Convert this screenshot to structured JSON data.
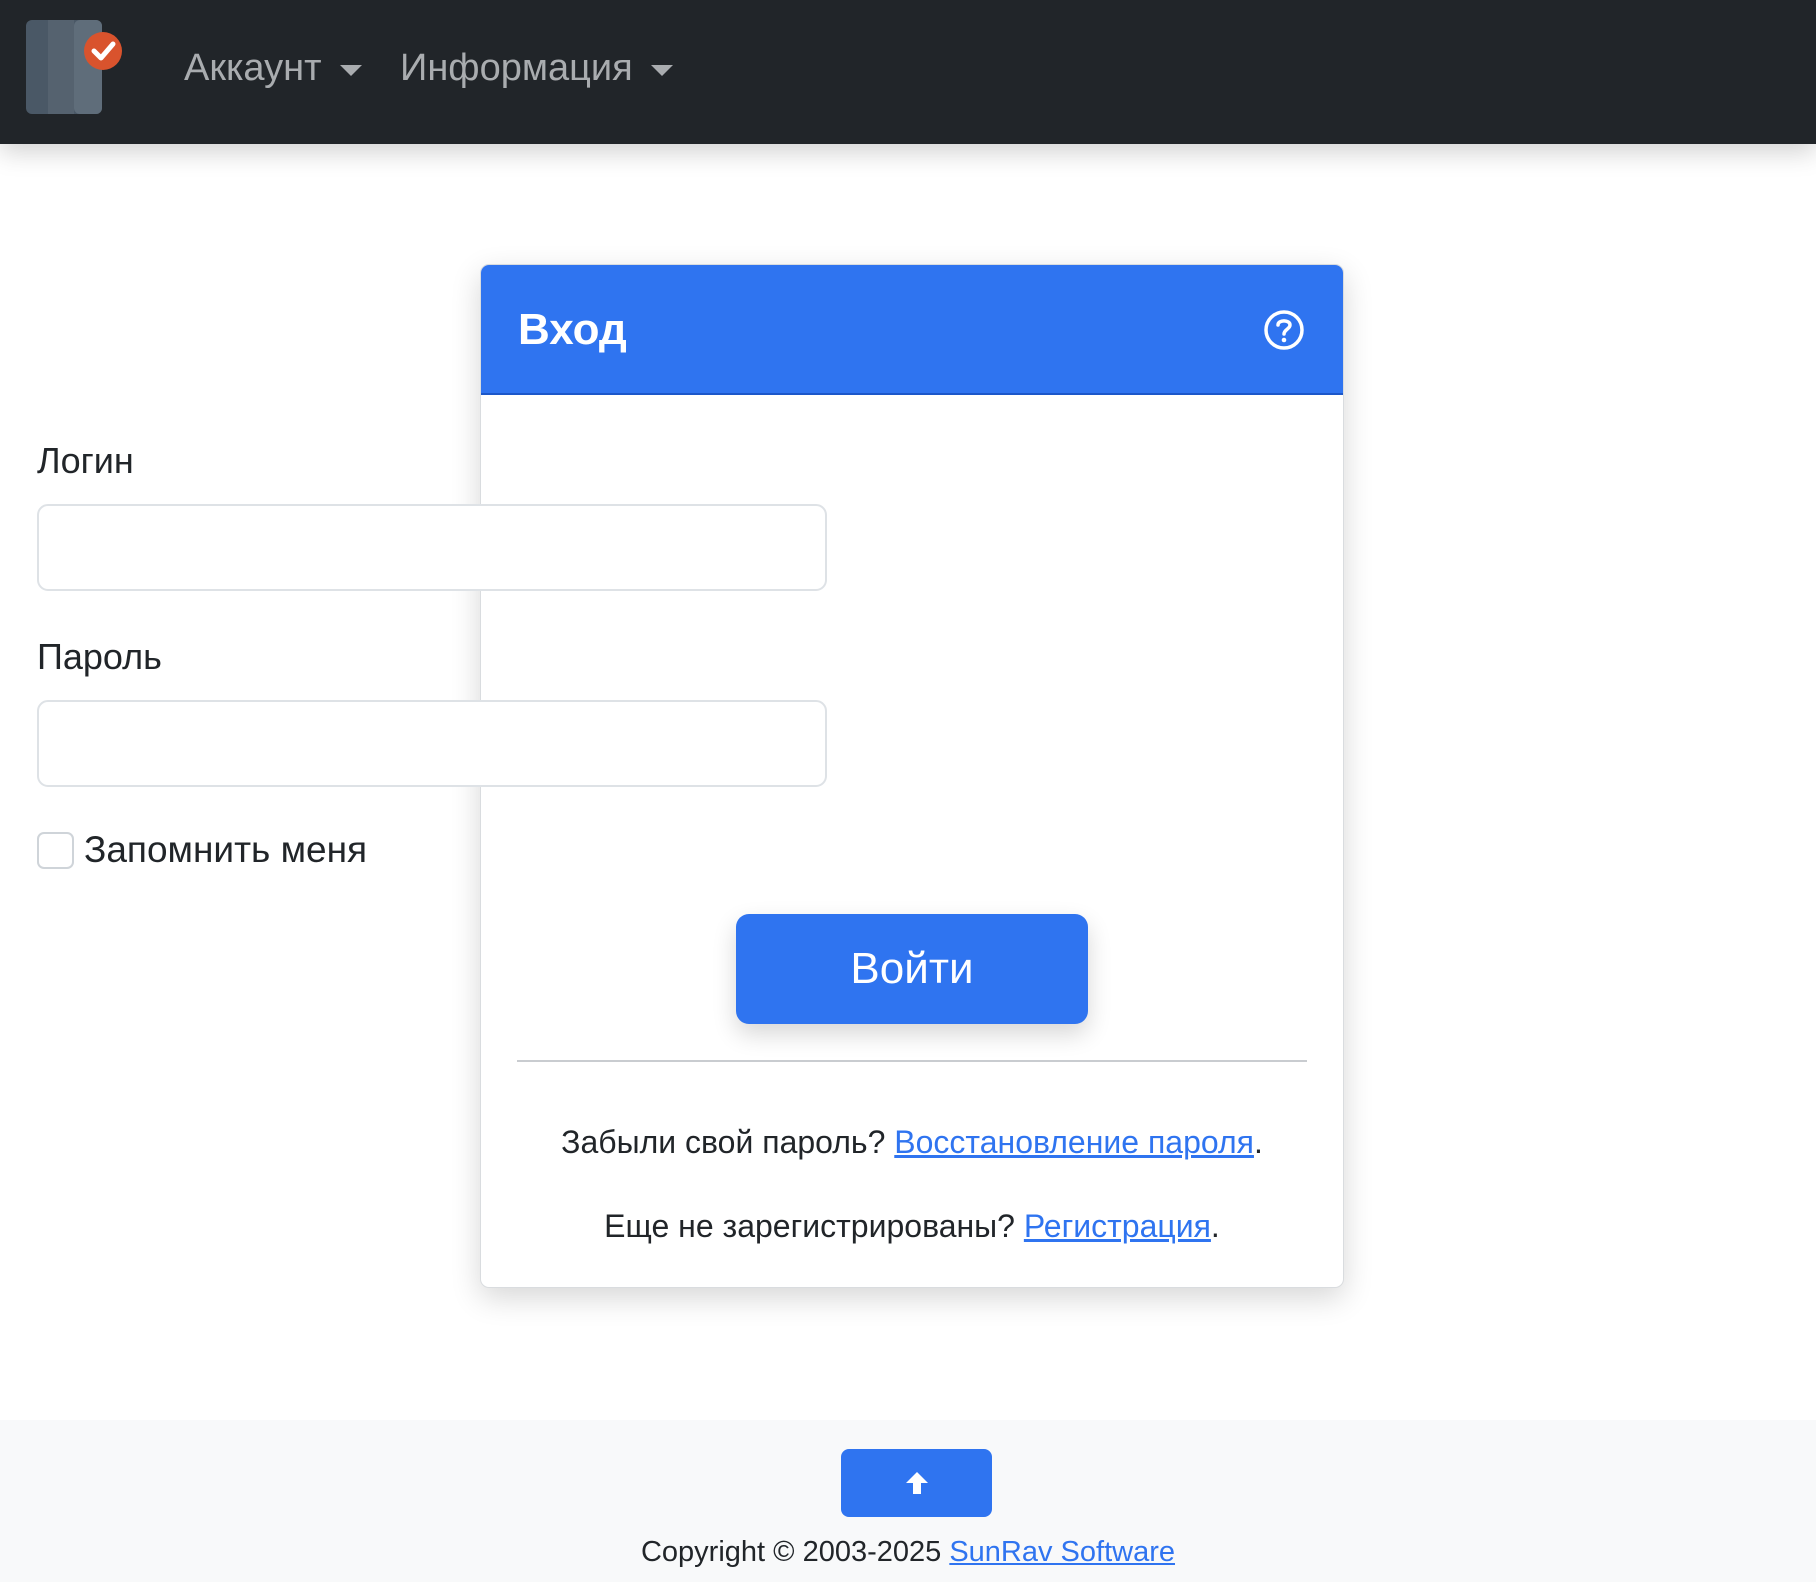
{
  "navbar": {
    "logo_name": "app-logo",
    "items": [
      {
        "label": "Аккаунт"
      },
      {
        "label": "Информация"
      }
    ]
  },
  "login_card": {
    "title": "Вход",
    "help_icon": "question-circle-icon",
    "login_label": "Логин",
    "login_value": "",
    "login_placeholder": "",
    "password_label": "Пароль",
    "password_value": "",
    "password_placeholder": "",
    "remember_label": "Запомнить меня",
    "remember_checked": false,
    "submit_label": "Войти",
    "forgot_text": "Забыли свой пароль? ",
    "forgot_link": "Восстановление пароля",
    "forgot_end": ".",
    "register_text": "Еще не зарегистрированы? ",
    "register_link": "Регистрация",
    "register_end": "."
  },
  "footer": {
    "scroll_top_icon": "arrow-up-icon",
    "copyright_text": "Copyright © 2003-2025 ",
    "company_link": "SunRav Software"
  },
  "colors": {
    "navbar_bg": "#212529",
    "primary": "#2f74f0",
    "footer_bg": "#f8f9fa"
  }
}
